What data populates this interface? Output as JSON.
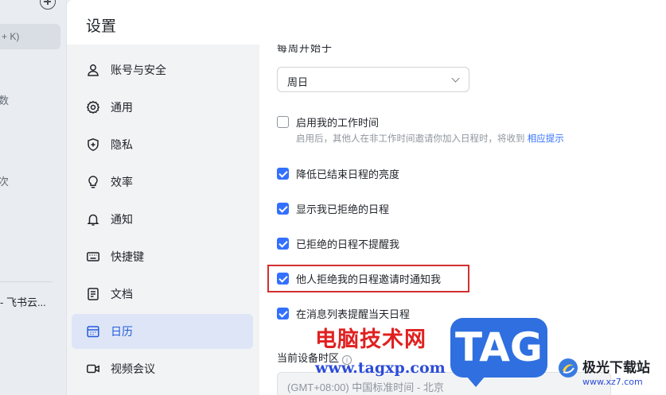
{
  "app_strip": {
    "search_shortcut": "+ K)",
    "partial_glyphs": [
      "数",
      "次"
    ],
    "chat_preview": "- 飞书云..."
  },
  "settings": {
    "title": "设置",
    "nav": [
      {
        "label": "账号与安全",
        "icon": "user-icon",
        "active": false
      },
      {
        "label": "通用",
        "icon": "gear-icon",
        "active": false
      },
      {
        "label": "隐私",
        "icon": "shield-icon",
        "active": false
      },
      {
        "label": "效率",
        "icon": "lightbulb-icon",
        "active": false
      },
      {
        "label": "通知",
        "icon": "bell-icon",
        "active": false
      },
      {
        "label": "快捷键",
        "icon": "keyboard-icon",
        "active": false
      },
      {
        "label": "文档",
        "icon": "document-icon",
        "active": false
      },
      {
        "label": "日历",
        "icon": "calendar-icon",
        "active": true
      },
      {
        "label": "视频会议",
        "icon": "video-icon",
        "active": false
      }
    ]
  },
  "calendar": {
    "cut_heading": "每周开始于",
    "week_start_value": "周日",
    "options": [
      {
        "label": "启用我的工作时间",
        "checked": false
      },
      {
        "label": "降低已结束日程的亮度",
        "checked": true
      },
      {
        "label": "显示我已拒绝的日程",
        "checked": true
      },
      {
        "label": "已拒绝的日程不提醒我",
        "checked": true
      },
      {
        "label": "他人拒绝我的日程邀请时通知我",
        "checked": true
      },
      {
        "label": "在消息列表提醒当天日程",
        "checked": true
      }
    ],
    "work_time_hint": "启用后，其他人在非工作时间邀请你加入日程时，将收到",
    "work_time_hint_link": "相应提示",
    "timezone_label": "当前设备时区",
    "timezone_info": "i",
    "timezone_value": "(GMT+08:00) 中国标准时间 - 北京"
  },
  "watermark": {
    "site_cn": "电脑技术网",
    "site_url": "www.tagxp.com",
    "tag": "TAG",
    "site2_cn": "极光下载站",
    "site2_url": "www.xz7.com"
  },
  "colors": {
    "accent": "#3370ff",
    "highlight_box": "#d32f2f",
    "active_nav_bg": "#dde5f7"
  }
}
